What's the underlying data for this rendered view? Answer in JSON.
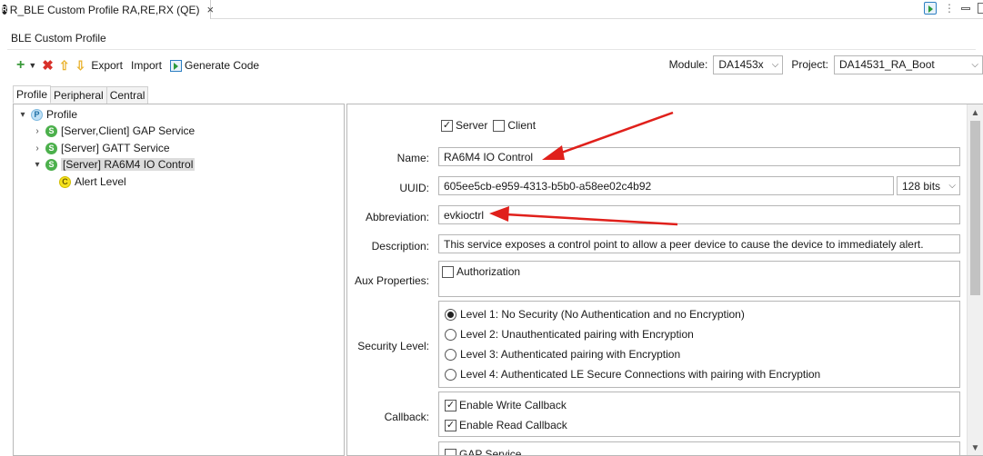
{
  "editor_tab": {
    "icon": "R",
    "title": "R_BLE Custom Profile RA,RE,RX (QE)",
    "close": "×"
  },
  "section": {
    "title": "BLE Custom Profile"
  },
  "toolbar": {
    "add": "+",
    "add_caret": "▼",
    "delete": "✖",
    "move_up": "⇧",
    "move_down": "⇩",
    "export_label": "Export",
    "import_label": "Import",
    "generate_label": "Generate Code"
  },
  "module": {
    "label": "Module:",
    "value": "DA1453x",
    "arrow": "⌵"
  },
  "project": {
    "label": "Project:",
    "value": "DA14531_RA_Boot",
    "arrow": "⌵"
  },
  "subtabs": {
    "profile": "Profile",
    "peripheral": "Peripheral",
    "central": "Central"
  },
  "tree": {
    "root": {
      "twist": "▾",
      "badge": "P",
      "label": "Profile"
    },
    "items": [
      {
        "twist": "›",
        "badge": "S",
        "label": "[Server,Client] GAP Service"
      },
      {
        "twist": "›",
        "badge": "S",
        "label": "[Server] GATT Service"
      },
      {
        "twist": "▾",
        "badge": "S",
        "label": "[Server] RA6M4 IO Control"
      },
      {
        "twist": "",
        "badge": "C",
        "label": "Alert Level"
      }
    ]
  },
  "form": {
    "role": {
      "server_label": "Server",
      "server_checked": true,
      "client_label": "Client",
      "client_checked": false
    },
    "name": {
      "label": "Name:",
      "value": "RA6M4 IO Control"
    },
    "uuid": {
      "label": "UUID:",
      "value": "605ee5cb-e959-4313-b5b0-a58ee02c4b92",
      "bits": "128 bits",
      "arrow": "⌵"
    },
    "abbreviation": {
      "label": "Abbreviation:",
      "value": "evkioctrl"
    },
    "description": {
      "label": "Description:",
      "value": "This service exposes a control point to allow a peer device to cause the device to immediately alert."
    },
    "aux": {
      "label": "Aux Properties:",
      "authorization_label": "Authorization",
      "authorization_checked": false
    },
    "security": {
      "label": "Security Level:",
      "options": [
        "Level 1: No Security (No Authentication and no Encryption)",
        "Level 2: Unauthenticated pairing with Encryption",
        "Level 3: Authenticated pairing with Encryption",
        "Level 4: Authenticated LE Secure Connections with pairing with Encryption"
      ],
      "selected_index": 0
    },
    "callback": {
      "label": "Callback:",
      "write_label": "Enable Write Callback",
      "write_checked": true,
      "read_label": "Enable Read Callback",
      "read_checked": true
    },
    "gap_service_partial": "GAP Service"
  },
  "scrollbar": {
    "up": "▲",
    "down": "▼"
  },
  "colors": {
    "annotation_arrow": "#e0201b",
    "tree_selection": "#dcdcdc",
    "service_badge": "#4cb04c"
  }
}
